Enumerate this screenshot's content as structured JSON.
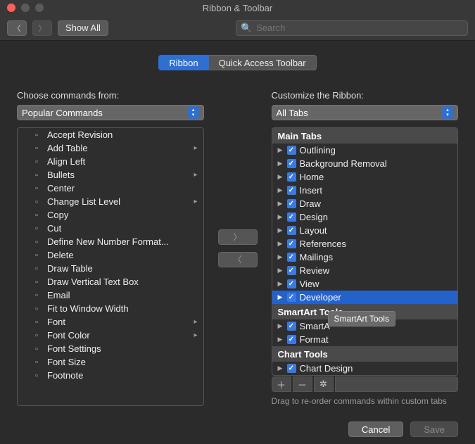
{
  "window": {
    "title": "Ribbon & Toolbar"
  },
  "toolbar": {
    "show_all": "Show All",
    "search_placeholder": "Search"
  },
  "tabs": {
    "ribbon": "Ribbon",
    "qat": "Quick Access Toolbar"
  },
  "left": {
    "label": "Choose commands from:",
    "dropdown": "Popular Commands",
    "items": [
      {
        "label": "Accept Revision"
      },
      {
        "label": "Add Table",
        "sub": true
      },
      {
        "label": "Align Left"
      },
      {
        "label": "Bullets",
        "sub": true
      },
      {
        "label": "Center"
      },
      {
        "label": "Change List Level",
        "sub": true
      },
      {
        "label": "Copy"
      },
      {
        "label": "Cut"
      },
      {
        "label": "Define New Number Format..."
      },
      {
        "label": "Delete"
      },
      {
        "label": "Draw Table"
      },
      {
        "label": "Draw Vertical Text Box"
      },
      {
        "label": "Email"
      },
      {
        "label": "Fit to Window Width"
      },
      {
        "label": "Font",
        "sub": true
      },
      {
        "label": "Font Color",
        "sub": true
      },
      {
        "label": "Font Settings"
      },
      {
        "label": "Font Size"
      },
      {
        "label": "Footnote"
      }
    ]
  },
  "right": {
    "label": "Customize the Ribbon:",
    "dropdown": "All Tabs",
    "groups": [
      {
        "header": "Main Tabs",
        "items": [
          "Outlining",
          "Background Removal",
          "Home",
          "Insert",
          "Draw",
          "Design",
          "Layout",
          "References",
          "Mailings",
          "Review",
          "View",
          "Developer"
        ],
        "selected": "Developer"
      },
      {
        "header": "SmartArt Tools",
        "items": [
          "SmartA",
          "Format"
        ]
      },
      {
        "header": "Chart Tools",
        "items": [
          "Chart Design"
        ]
      }
    ],
    "tooltip": "SmartArt Tools",
    "hint": "Drag to re-order commands within custom tabs"
  },
  "footer": {
    "cancel": "Cancel",
    "save": "Save"
  }
}
